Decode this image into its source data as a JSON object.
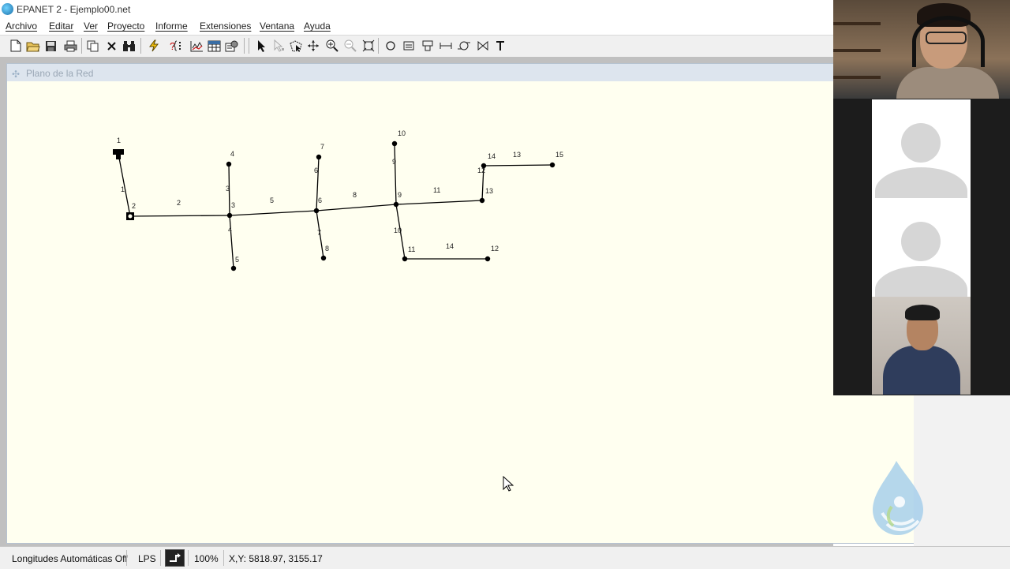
{
  "window": {
    "title": "EPANET 2 - Ejemplo00.net"
  },
  "menu": [
    "Archivo",
    "Editar",
    "Ver",
    "Proyecto",
    "Informe",
    "Extensiones",
    "Ventana",
    "Ayuda"
  ],
  "toolbar": {
    "file_tools": [
      "new-icon",
      "open-icon",
      "save-icon",
      "print-icon"
    ],
    "edit_tools": [
      "copy-icon",
      "delete-icon",
      "find-icon"
    ],
    "run_tools": [
      "run-icon",
      "query-icon",
      "graph-icon",
      "table-icon",
      "options-icon"
    ],
    "map_tools": [
      "select-icon",
      "vertex-icon",
      "select-region-icon",
      "pan-icon",
      "zoom-in-icon",
      "zoom-out-icon",
      "full-extent-icon",
      "junction-icon",
      "reservoir-icon",
      "tank-icon",
      "pipe-icon",
      "pump-icon",
      "valve-icon",
      "text-icon"
    ]
  },
  "map": {
    "title": "Plano de la Red",
    "nodes": [
      {
        "id": "1",
        "type": "reservoir"
      },
      {
        "id": "2",
        "type": "pump-node"
      },
      {
        "id": "3"
      },
      {
        "id": "4"
      },
      {
        "id": "5"
      },
      {
        "id": "6"
      },
      {
        "id": "7"
      },
      {
        "id": "8"
      },
      {
        "id": "9"
      },
      {
        "id": "10"
      },
      {
        "id": "11"
      },
      {
        "id": "12"
      },
      {
        "id": "13"
      },
      {
        "id": "14"
      },
      {
        "id": "15"
      }
    ],
    "links": [
      {
        "id": "1",
        "from": "1",
        "to": "2"
      },
      {
        "id": "2",
        "from": "2",
        "to": "3"
      },
      {
        "id": "3",
        "from": "3",
        "to": "4"
      },
      {
        "id": "4",
        "from": "3",
        "to": "5"
      },
      {
        "id": "5",
        "from": "3",
        "to": "6"
      },
      {
        "id": "6",
        "from": "6",
        "to": "7"
      },
      {
        "id": "7",
        "from": "6",
        "to": "8"
      },
      {
        "id": "8",
        "from": "6",
        "to": "9"
      },
      {
        "id": "9",
        "from": "9",
        "to": "10"
      },
      {
        "id": "10",
        "from": "9",
        "to": "11"
      },
      {
        "id": "11",
        "from": "9",
        "to": "13"
      },
      {
        "id": "12",
        "from": "13",
        "to": "14"
      },
      {
        "id": "13",
        "from": "14",
        "to": "15"
      },
      {
        "id": "14",
        "from": "11",
        "to": "12"
      }
    ]
  },
  "status": {
    "auto_length": "Longitudes Automáticas Off",
    "flow_units": "LPS",
    "zoom": "100%",
    "coords": "X,Y: 5818.97, 3155.17"
  },
  "colors": {
    "canvas": "#fffff0",
    "link": "#000000",
    "node": "#000000"
  }
}
